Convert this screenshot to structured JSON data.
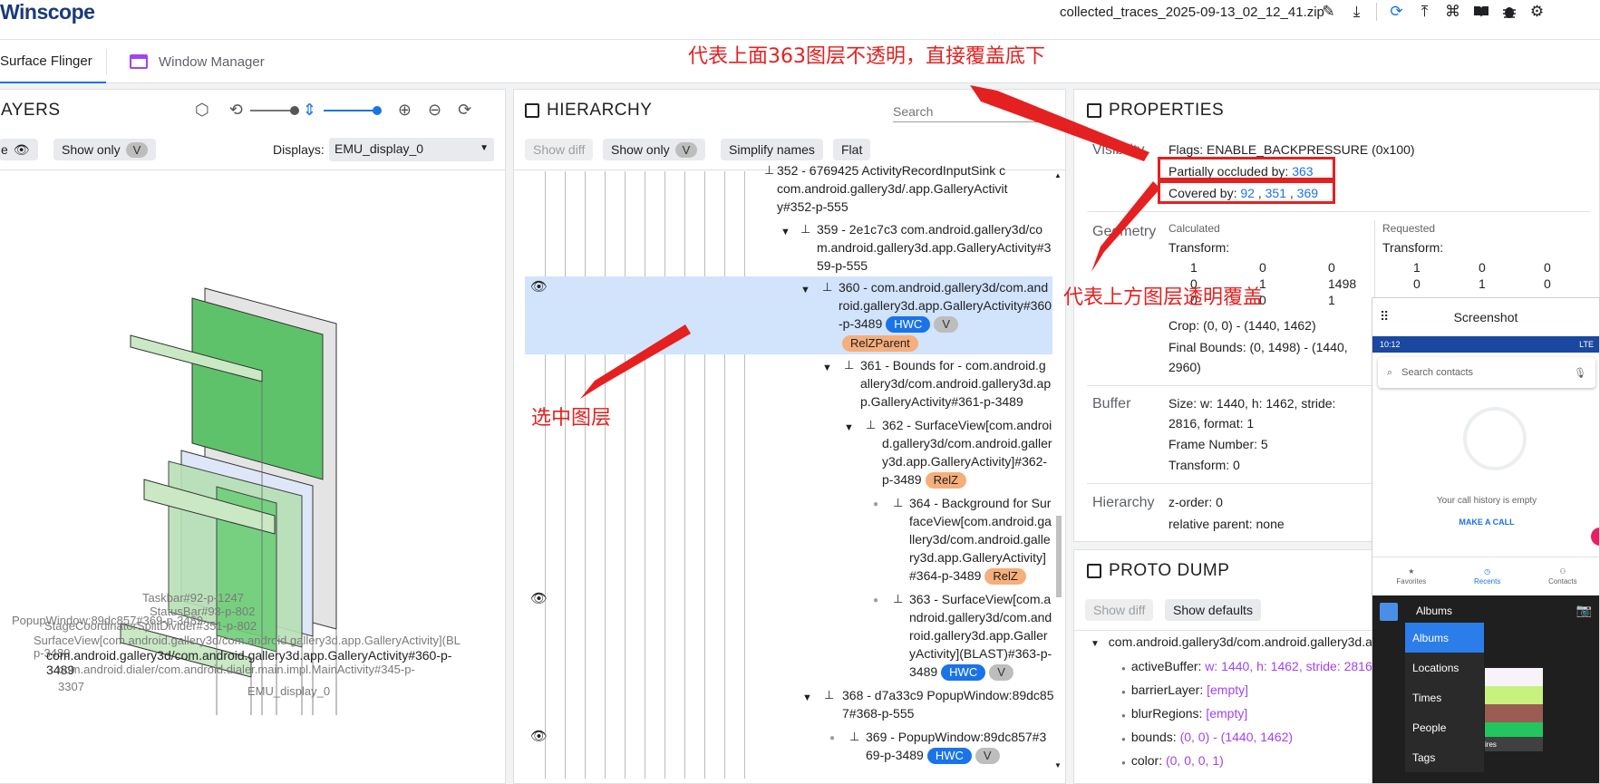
{
  "app": {
    "logo": "Winscope",
    "filename": "collected_traces_2025-09-13_02_12_41.zip"
  },
  "tabs": [
    {
      "label": "Surface Flinger",
      "active": true
    },
    {
      "label": "Window Manager",
      "active": false
    }
  ],
  "layers": {
    "title": "AYERS",
    "show_only_label": "Show only",
    "show_only_badge": "V",
    "partial_label": "e",
    "displays_label": "Displays:",
    "displays_value": "EMU_display_0",
    "labels": {
      "taskbar": "Taskbar#92-p-1247",
      "statusbar": "StatusBar#93-p-802",
      "popup": "PopupWindow:89dc857#369-p-3489",
      "stagecoord": "StageCoordinatorSplitDivider#351-p-802",
      "surfaceview": "SurfaceView[com.android.gallery3d/com.android.gallery3d.app.GalleryActivity](BL",
      "surfaceview2": "p-3489",
      "gallery": "com.android.gallery3d/com.android.gallery3d.app.GalleryActivity#360-p-",
      "gallery2": "3489",
      "dialer": "com.android.dialer/com.android.dialer.main.impl.MainActivity#345-p-",
      "dialer2": "3307",
      "display": "EMU_display_0"
    }
  },
  "hierarchy": {
    "title": "HIERARCHY",
    "search_placeholder": "Search",
    "show_diff": "Show diff",
    "show_only": "Show only",
    "show_only_badge": "V",
    "simplify": "Simplify names",
    "flat": "Flat",
    "rows": {
      "r352a": "352 - 6769425 ActivityRecordInputSink c",
      "r352b": "com.android.gallery3d/.app.GalleryActivit",
      "r352c": "y#352-p-555",
      "r359a": "359 - 2e1c7c3 com.android.gallery3d/co",
      "r359b": "m.android.gallery3d.app.GalleryActivity#3",
      "r359c": "59-p-555",
      "r360a": "360 - com.android.gallery3d/com.and",
      "r360b": "roid.gallery3d.app.GalleryActivity#360",
      "r360c": "-p-3489",
      "r361a": "361 - Bounds for - com.android.g",
      "r361b": "allery3d/com.android.gallery3d.ap",
      "r361c": "p.GalleryActivity#361-p-3489",
      "r362a": "362 - SurfaceView[com.androi",
      "r362b": "d.gallery3d/com.android.galler",
      "r362c": "y3d.app.GalleryActivity]#362-",
      "r362d": "p-3489",
      "r364a": "364 - Background for Sur",
      "r364b": "faceView[com.android.ga",
      "r364c": "llery3d/com.android.galle",
      "r364d": "ry3d.app.GalleryActivity]",
      "r364e": "#364-p-3489",
      "r363a": "363 - SurfaceView[com.a",
      "r363b": "ndroid.gallery3d/com.and",
      "r363c": "roid.gallery3d.app.Galler",
      "r363d": "yActivity](BLAST)#363-p-",
      "r363e": "3489",
      "r368a": "368 - d7a33c9 PopupWindow:89dc85",
      "r368b": "7#368-p-555",
      "r369a": "369 - PopupWindow:89dc857#3",
      "r369b": "69-p-3489"
    },
    "tags": {
      "hwc": "HWC",
      "v": "V",
      "relzparent": "RelZParent",
      "relz": "RelZ"
    }
  },
  "properties": {
    "title": "PROPERTIES",
    "visibility_label": "Visibility",
    "flags": "Flags: ENABLE_BACKPRESSURE (0x100)",
    "partially_occluded_label": "Partially occluded by:",
    "partially_occluded_value": "363",
    "covered_by_label": "Covered by:",
    "covered_1": "92",
    "covered_2": "351",
    "covered_3": "369",
    "covered_sep": ",",
    "geometry_label": "Geometry",
    "calculated": "Calculated",
    "requested": "Requested",
    "transform": "Transform:",
    "m": {
      "c11": "1",
      "c12": "0",
      "c13": "0",
      "c21": "0",
      "c22": "1",
      "c23": "1498",
      "c31": "0",
      "c32": "0",
      "c33": "1",
      "r11": "1",
      "r12": "0",
      "r13": "0",
      "r21": "0",
      "r22": "1",
      "r23": "0"
    },
    "crop": "Crop: (0, 0) - (1440, 1462)",
    "final_bounds_a": "Final Bounds: (0, 1498) - (1440,",
    "final_bounds_b": "2960)",
    "buffer_label": "Buffer",
    "buffer_a": "Size: w: 1440, h: 1462, stride:",
    "buffer_b": "2816, format: 1",
    "frame_number": "Frame Number: 5",
    "buffer_transform": "Transform: 0",
    "hierarchy_label": "Hierarchy",
    "zorder": "z-order: 0",
    "relative_parent": "relative parent: none"
  },
  "proto": {
    "title": "PROTO DUMP",
    "show_diff": "Show diff",
    "show_defaults": "Show defaults",
    "root": "com.android.gallery3d/com.android.gallery3d.a",
    "items": [
      {
        "key": "activeBuffer:",
        "val": "w: 1440, h: 1462, stride: 2816"
      },
      {
        "key": "barrierLayer:",
        "val": "[empty]"
      },
      {
        "key": "blurRegions:",
        "val": "[empty]"
      },
      {
        "key": "bounds:",
        "val": "(0, 0) - (1440, 1462)"
      },
      {
        "key": "color:",
        "val": "(0, 0, 0, 1)"
      }
    ]
  },
  "phone": {
    "title": "Screenshot",
    "time": "10:12",
    "network": "LTE",
    "search": "Search contacts",
    "empty": "Your call history is empty",
    "make_call": "MAKE A CALL",
    "nav": [
      "Favorites",
      "Recents",
      "Contacts"
    ],
    "gallery_title": "Albums",
    "gallery_sel": "ires",
    "dropdown": [
      "Albums",
      "Locations",
      "Times",
      "People",
      "Tags"
    ]
  },
  "annotations": {
    "top": "代表上面363图层不透明，直接覆盖底下",
    "covered": "代表上方图层透明覆盖",
    "selected": "选中图层"
  },
  "colors": {
    "accent": "#1a73e8",
    "annotation": "#e52020",
    "selected_row": "#d2e3fc",
    "relz": "#f6ae7b"
  }
}
